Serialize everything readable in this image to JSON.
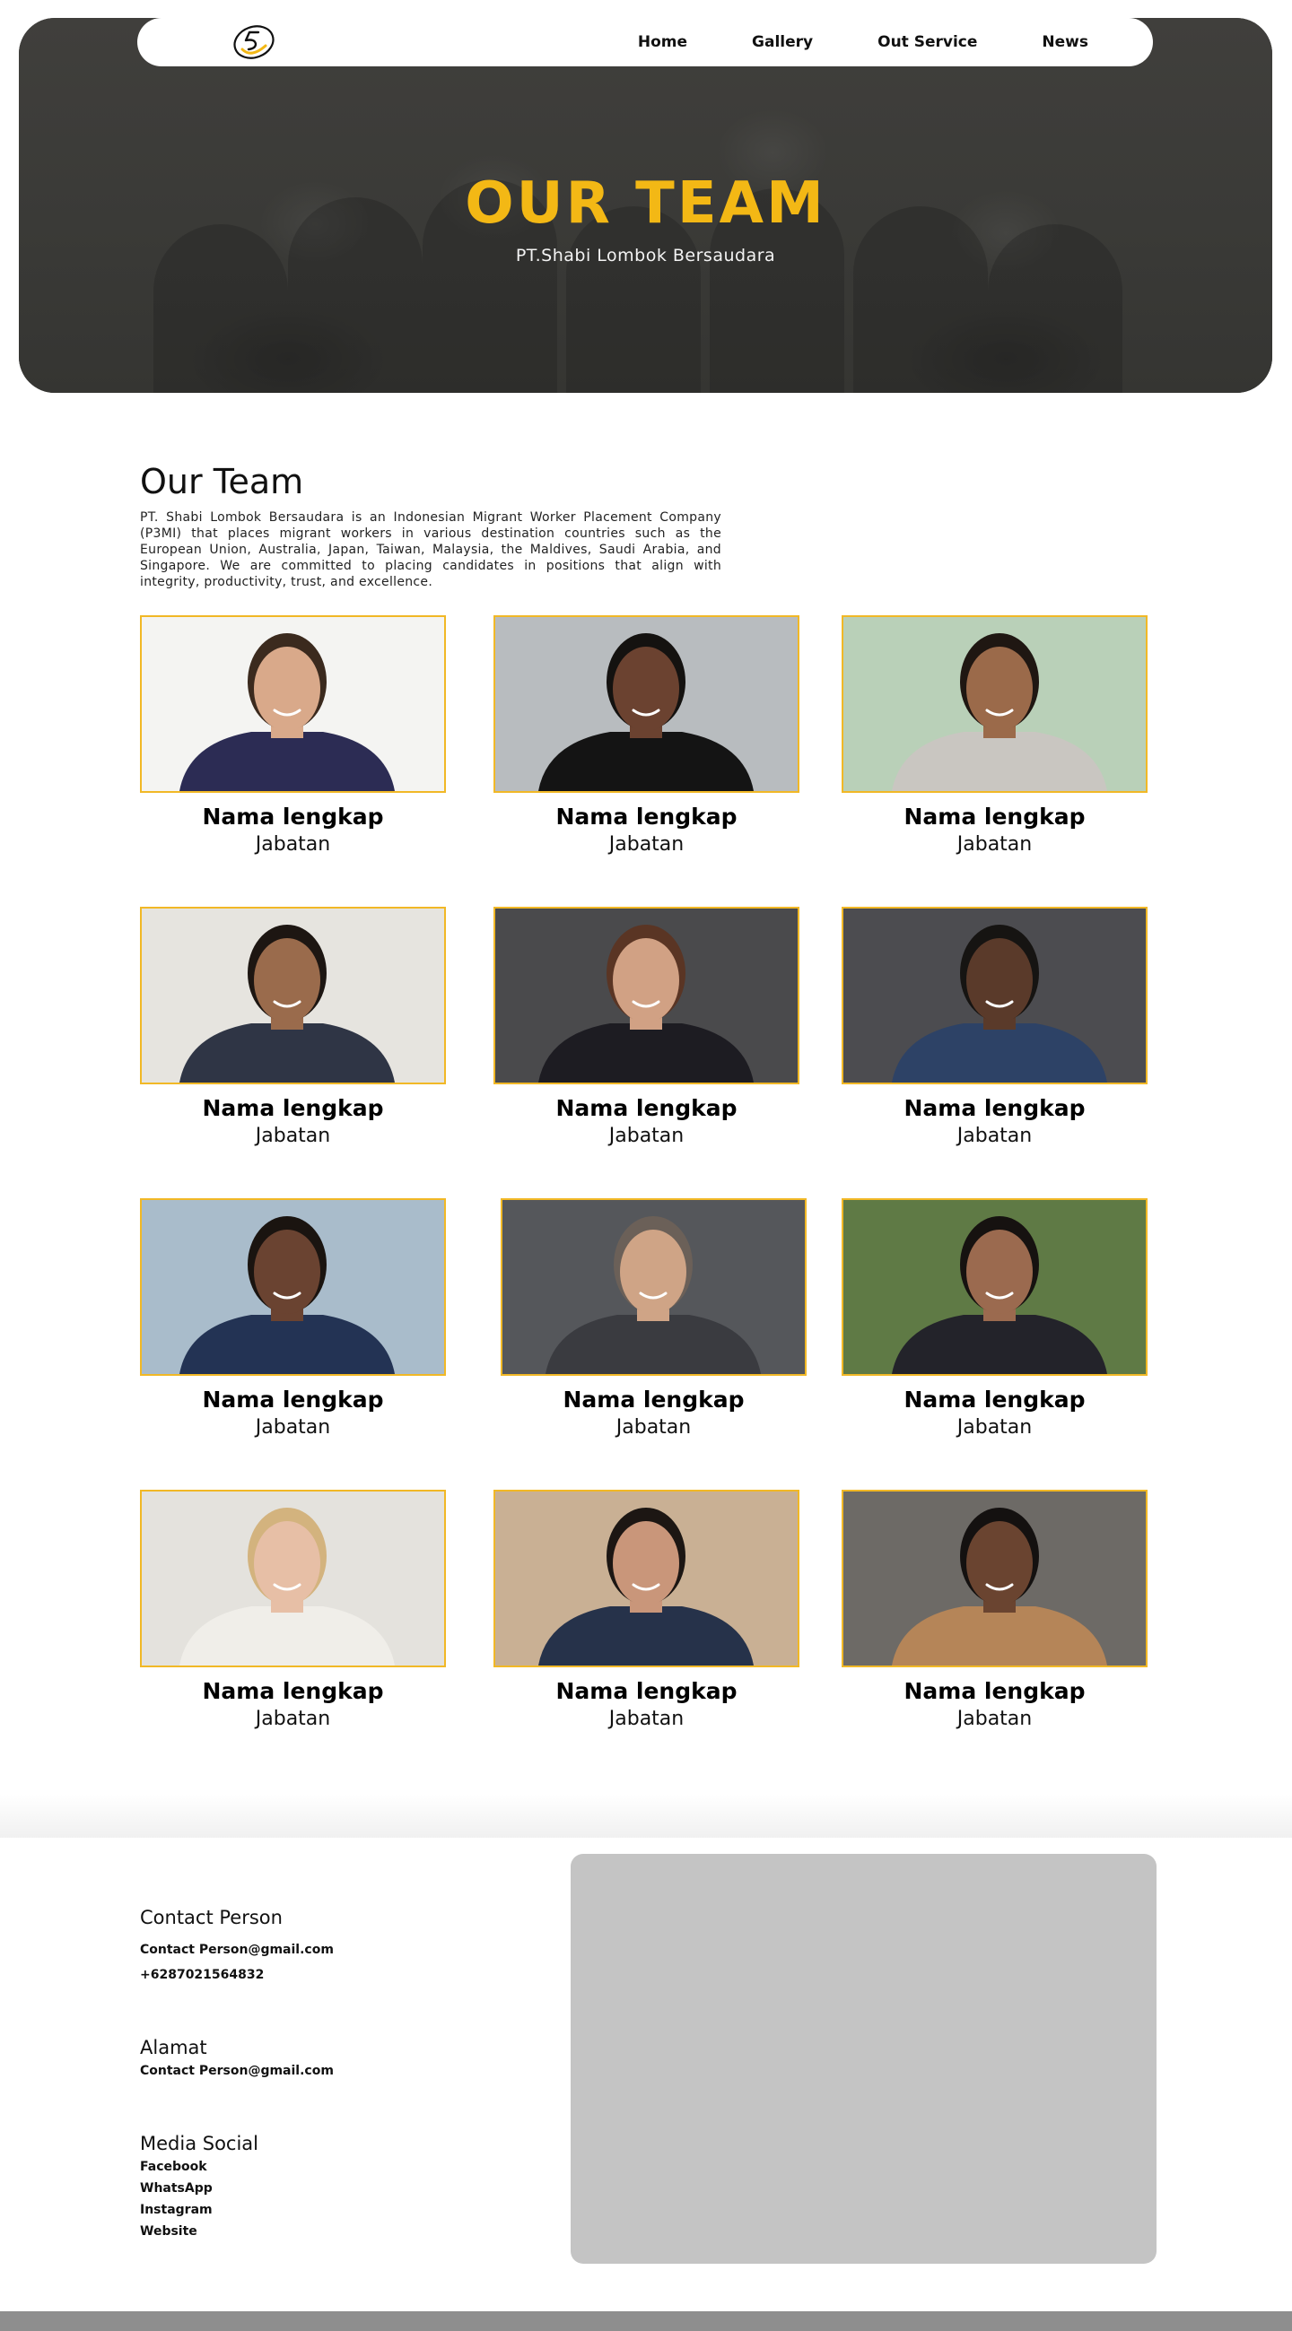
{
  "nav": {
    "links": [
      {
        "label": "Home"
      },
      {
        "label": "Gallery"
      },
      {
        "label": "Out Service"
      },
      {
        "label": "News"
      }
    ]
  },
  "hero": {
    "title": "OUR TEAM",
    "subtitle": "PT.Shabi Lombok Bersaudara"
  },
  "intro": {
    "title": "Our Team",
    "description": "PT. Shabi Lombok Bersaudara is an Indonesian Migrant Worker Placement Company (P3MI) that places migrant workers in various destination countries such as the European Union, Australia, Japan, Taiwan, Malaysia, the Maldives, Saudi Arabia, and Singapore. We are committed to placing candidates in positions that align with integrity, productivity, trust, and excellence."
  },
  "team": [
    {
      "name": "Nama lengkap",
      "role": "Jabatan"
    },
    {
      "name": "Nama lengkap",
      "role": "Jabatan"
    },
    {
      "name": "Nama lengkap",
      "role": "Jabatan"
    },
    {
      "name": "Nama lengkap",
      "role": "Jabatan"
    },
    {
      "name": "Nama lengkap",
      "role": "Jabatan"
    },
    {
      "name": "Nama lengkap",
      "role": "Jabatan"
    },
    {
      "name": "Nama lengkap",
      "role": "Jabatan"
    },
    {
      "name": "Nama lengkap",
      "role": "Jabatan"
    },
    {
      "name": "Nama lengkap",
      "role": "Jabatan"
    },
    {
      "name": "Nama lengkap",
      "role": "Jabatan"
    },
    {
      "name": "Nama lengkap",
      "role": "Jabatan"
    },
    {
      "name": "Nama lengkap",
      "role": "Jabatan"
    }
  ],
  "footer": {
    "contact": {
      "heading": "Contact Person",
      "email": "Contact Person@gmail.com",
      "phone": "+6287021564832"
    },
    "address": {
      "heading": "Alamat",
      "text": "Contact Person@gmail.com"
    },
    "social": {
      "heading": "Media Social",
      "links": [
        {
          "label": "Facebook"
        },
        {
          "label": "WhatsApp"
        },
        {
          "label": "Instagram"
        },
        {
          "label": "Website"
        }
      ]
    }
  },
  "colors": {
    "accent": "#f3b815",
    "hero_bg": "#3a3a38",
    "map_placeholder": "#c4c4c4",
    "bottom_bar": "#8e8e8e"
  }
}
